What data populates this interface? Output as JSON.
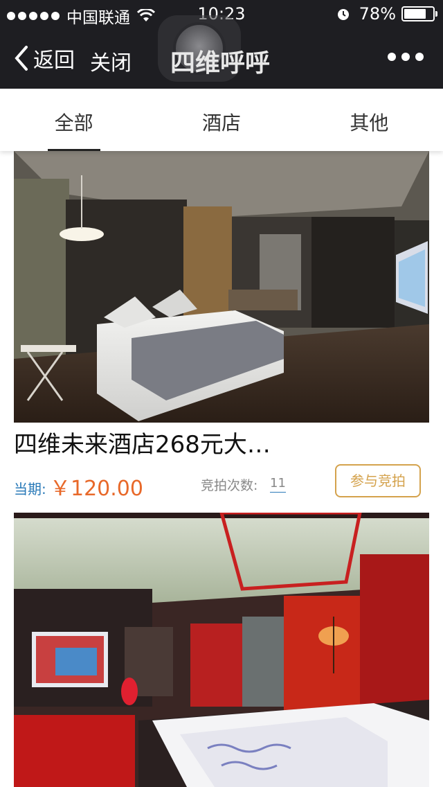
{
  "status_bar": {
    "carrier": "中国联通",
    "time": "10:23",
    "battery": "78%",
    "battery_level": 0.78
  },
  "nav": {
    "back_label": "返回",
    "close_label": "关闭",
    "title": "四维呼呼"
  },
  "tabs": [
    {
      "label": "全部",
      "active": true
    },
    {
      "label": "酒店",
      "active": false
    },
    {
      "label": "其他",
      "active": false
    }
  ],
  "items": [
    {
      "title": "四维未来酒店268元大…",
      "period_label": "当期:",
      "price": "￥120.00",
      "bid_label": "竞拍次数:",
      "bid_count": "11",
      "button_label": "参与竞拍"
    }
  ],
  "colors": {
    "bar_bg": "#1e1e22",
    "price": "#e8692a",
    "accent_blue": "#2a7ab8",
    "button_gold": "#d4a24c"
  }
}
